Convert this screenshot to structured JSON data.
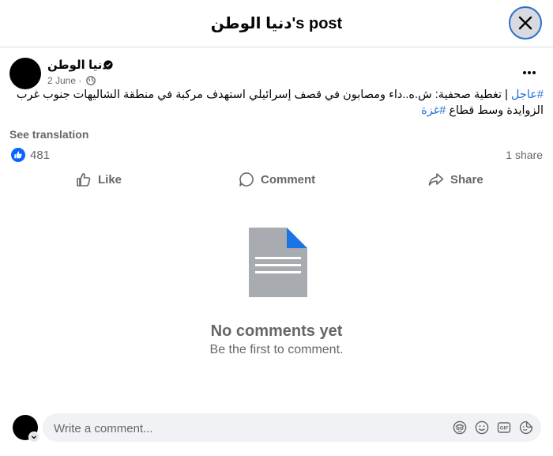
{
  "header": {
    "title": "دنيا الوطن's post"
  },
  "post": {
    "author": "دنيا الوطن",
    "date": "2 June",
    "meta_sep": "·",
    "text_line1": "| تغطية صحفية: ش.ه..داء ومصابون في قصف إسرائيلي استهدف مركبة في منطقة الشاليهات جنوب غرب",
    "hashtag1": "#عاجل",
    "text_line2": "الزوايدة وسط قطاع ",
    "hashtag2": "#غزة",
    "see_translation": "See translation",
    "reaction_count": "481",
    "share_count": "1 share"
  },
  "actions": {
    "like": "Like",
    "comment": "Comment",
    "share": "Share"
  },
  "empty": {
    "title": "No comments yet",
    "subtitle": "Be the first to comment."
  },
  "composer": {
    "placeholder": "Write a comment..."
  },
  "icons": {
    "close": "close-icon",
    "verified": "verified-badge-icon",
    "globe": "globe-icon",
    "more": "more-options-icon",
    "like_badge": "like-reaction-icon",
    "document": "document-icon",
    "avatar_sticker": "avatar-sticker-icon",
    "emoji": "emoji-icon",
    "gif": "gif-icon",
    "sticker": "sticker-icon"
  },
  "colors": {
    "accent": "#0866ff",
    "link": "#216fdb",
    "muted": "#65676b"
  }
}
